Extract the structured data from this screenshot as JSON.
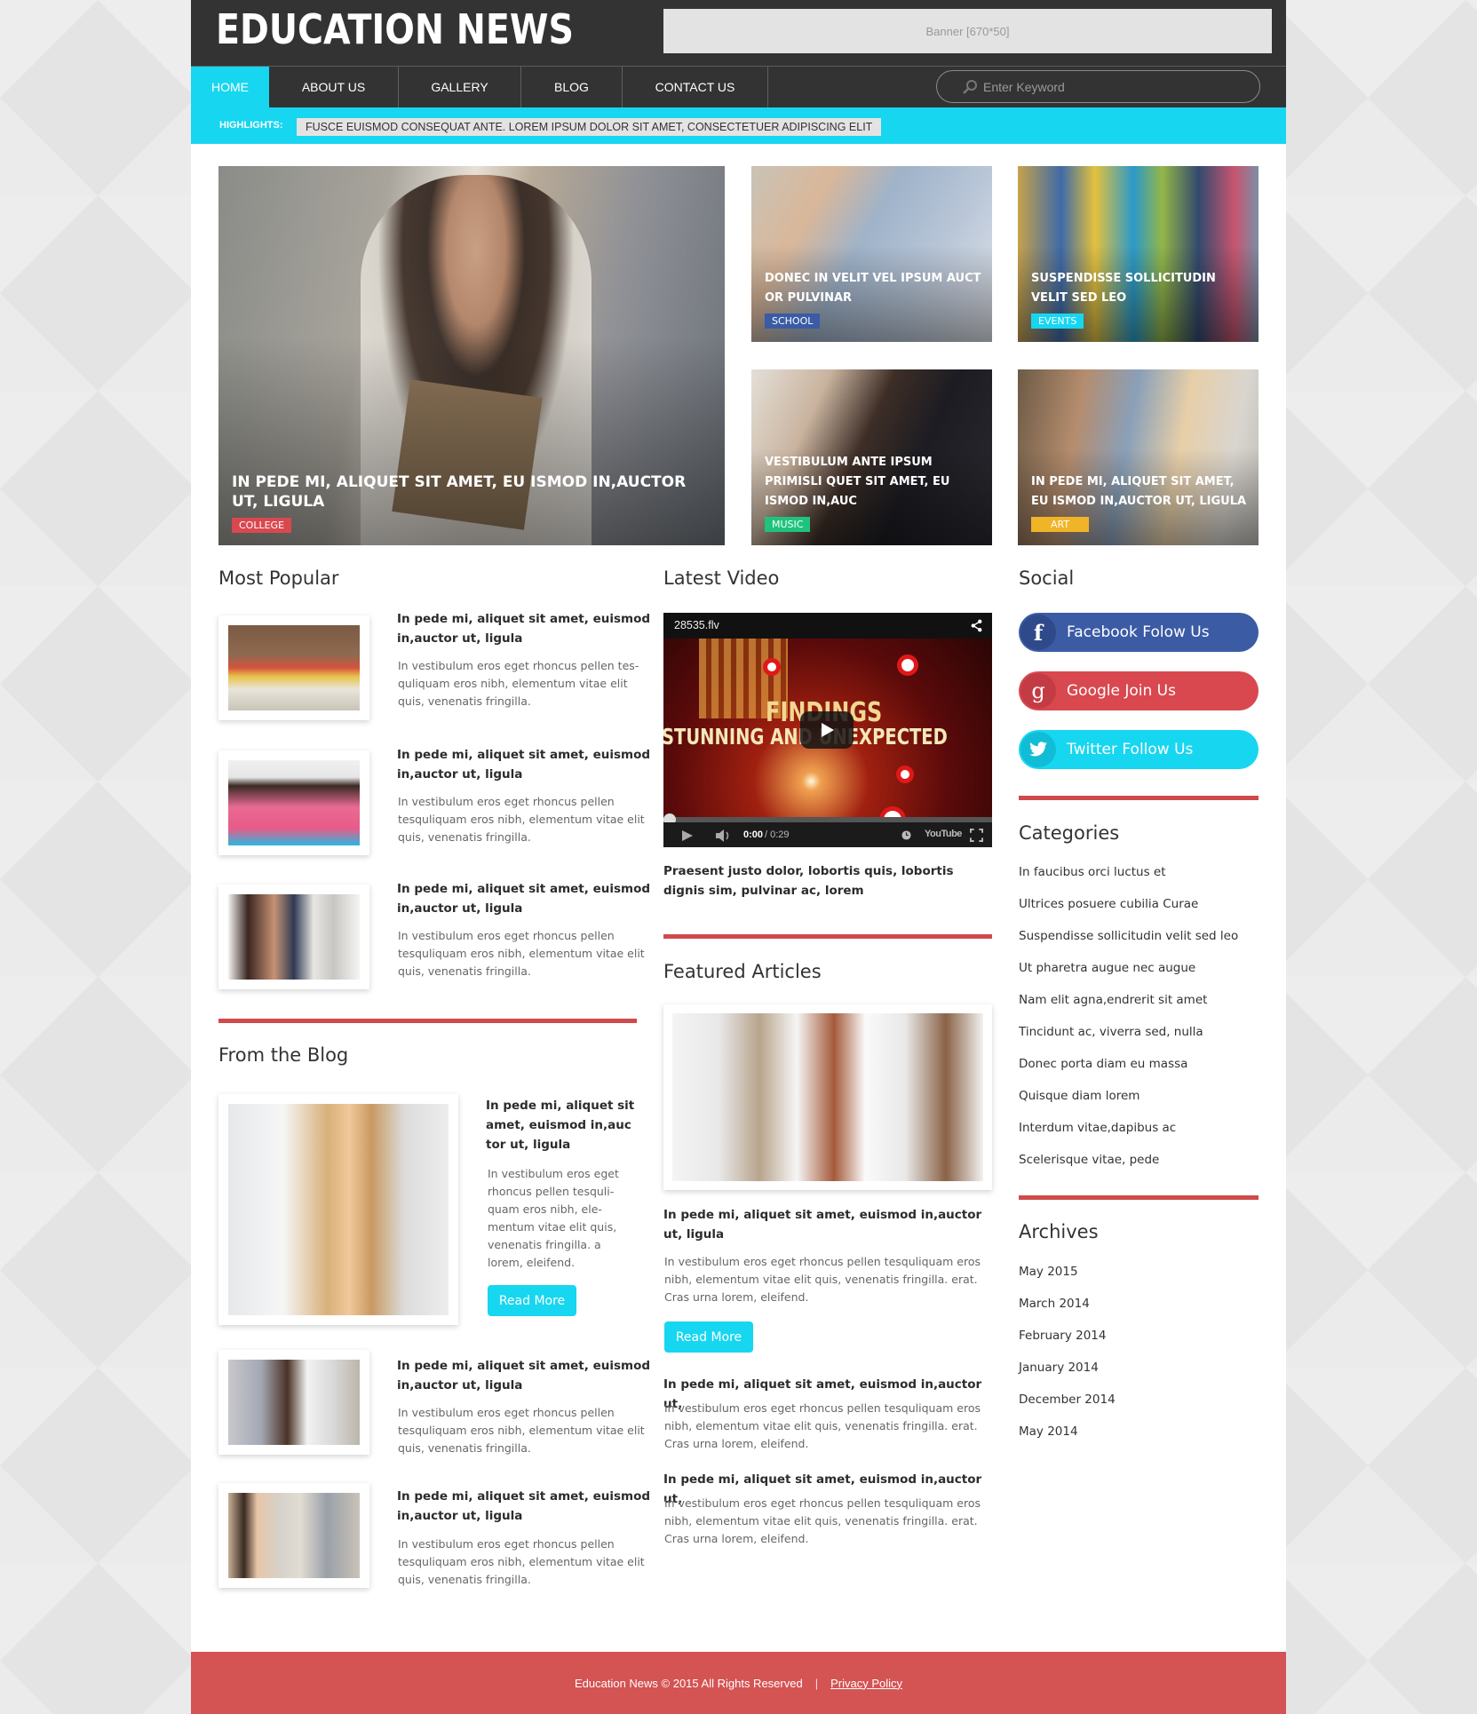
{
  "site": {
    "logo": "EDUCATION NEWS",
    "banner": "Banner [670*50]"
  },
  "nav": {
    "items": [
      {
        "label": "HOME",
        "active": true
      },
      {
        "label": "ABOUT US",
        "active": false
      },
      {
        "label": "GALLERY",
        "active": false
      },
      {
        "label": "BLOG",
        "active": false
      },
      {
        "label": "CONTACT US",
        "active": false
      }
    ],
    "search_placeholder": "Enter Keyword",
    "search_value": ""
  },
  "highlights": {
    "label": "HIGHLIGHTS:",
    "text": "FUSCE EUISMOD CONSEQUAT ANTE. LOREM IPSUM DOLOR SIT AMET, CONSECTETUER ADIPISCING ELIT"
  },
  "hero": {
    "main": {
      "title": "IN PEDE MI, ALIQUET SIT AMET, EU ISMOD IN,AUCTOR UT, LIGULA",
      "tag": "COLLEGE",
      "tag_color": "#d9484f"
    },
    "tiles": [
      {
        "title": "DONEC IN VELIT VEL IPSUM AUCT OR PULVINAR",
        "tag": "SCHOOL",
        "tag_color": "#3b5ba5"
      },
      {
        "title": "SUSPENDISSE SOLLICITUDIN VELIT SED LEO",
        "tag": "EVENTS",
        "tag_color": "#17d6f0"
      },
      {
        "title": "VESTIBULUM ANTE IPSUM PRIMISLI QUET SIT AMET, EU ISMOD IN,AUC",
        "tag": "MUSIC",
        "tag_color": "#1fc37e"
      },
      {
        "title": "IN PEDE MI, ALIQUET SIT AMET, EU ISMOD IN,AUCTOR UT, LIGULA",
        "tag": "ART",
        "tag_color": "#f0b429"
      }
    ]
  },
  "most_popular": {
    "heading": "Most Popular",
    "items": [
      {
        "title": "In pede mi, aliquet sit amet, euismod in,auctor ut, ligula",
        "text": "In vestibulum eros eget rhoncus pellen tes-quliquam eros nibh, elementum vitae elit quis, venenatis fringilla."
      },
      {
        "title": "In pede mi, aliquet sit amet, euismod in,auctor ut, ligula",
        "text": "In vestibulum eros eget rhoncus pellen tesquliquam eros nibh, elementum vitae elit quis, venenatis fringilla."
      },
      {
        "title": "In pede mi, aliquet sit amet, euismod in,auctor ut, ligula",
        "text": "In vestibulum eros eget rhoncus pellen tesquliquam eros nibh, elementum vitae elit quis, venenatis fringilla."
      }
    ]
  },
  "blog": {
    "heading": "From the Blog",
    "featured": {
      "title": "In pede mi, aliquet sit amet, euismod in,auc tor ut, ligula",
      "text": "In vestibulum eros eget rhoncus pellen tesquli-quam eros nibh, ele-mentum vitae elit quis, venenatis fringilla. a lorem, eleifend.",
      "button": "Read More"
    },
    "items": [
      {
        "title": "In pede mi, aliquet sit amet, euismod in,auctor ut, ligula",
        "text": "In vestibulum eros eget rhoncus pellen tesquliquam eros nibh, elementum vitae elit quis, venenatis fringilla."
      },
      {
        "title": "In pede mi, aliquet sit amet, euismod in,auctor ut, ligula",
        "text": "In vestibulum eros eget rhoncus pellen tesquliquam eros nibh, elementum vitae elit quis, venenatis fringilla."
      }
    ]
  },
  "video": {
    "heading": "Latest Video",
    "filename": "28535.flv",
    "overlay_line1": "FINDINGS",
    "overlay_line2": "STUNNING AND UNEXPECTED",
    "time_current": "0:00",
    "time_total": "/ 0:29",
    "progress": 0,
    "brand": "YouTube",
    "caption": "Praesent justo dolor, lobortis quis, lobortis dignis sim, pulvinar ac, lorem"
  },
  "featured": {
    "heading": "Featured Articles",
    "main": {
      "title": "In pede mi, aliquet sit amet, euismod in,auctor ut, ligula",
      "text": "In vestibulum eros eget rhoncus pellen tesquliquam eros nibh, elementum vitae elit quis, venenatis fringilla. erat. Cras urna lorem, eleifend.",
      "button": "Read More"
    },
    "items": [
      {
        "title": "In pede mi, aliquet sit amet, euismod in,auctor ut,",
        "text": "In vestibulum eros eget rhoncus pellen tesquliquam eros nibh, elementum vitae elit quis, venenatis fringilla. erat. Cras urna lorem, eleifend."
      },
      {
        "title": "In pede mi, aliquet sit amet, euismod in,auctor ut,",
        "text": "In vestibulum eros eget rhoncus pellen tesquliquam eros nibh, elementum vitae elit quis, venenatis fringilla. erat. Cras urna lorem, eleifend."
      }
    ]
  },
  "social": {
    "heading": "Social",
    "buttons": [
      {
        "label": "Facebook Folow Us",
        "icon": "f",
        "color": "#3b5ba5",
        "icon_bg": "#2f4a8a"
      },
      {
        "label": "Google Join Us",
        "icon": "g",
        "color": "#d9484f",
        "icon_bg": "#c43c43"
      },
      {
        "label": "Twitter Follow Us",
        "icon": "bird",
        "color": "#17d6f0",
        "icon_bg": "#12bcd6"
      }
    ]
  },
  "categories": {
    "heading": "Categories",
    "items": [
      "In faucibus orci luctus et",
      "Ultrices posuere cubilia Curae",
      "Suspendisse sollicitudin velit sed leo",
      "Ut pharetra augue nec augue",
      "Nam elit agna,endrerit sit amet",
      "Tincidunt ac, viverra sed, nulla",
      "Donec porta diam eu massa",
      "Quisque diam lorem",
      "Interdum vitae,dapibus ac",
      "Scelerisque vitae, pede"
    ]
  },
  "archives": {
    "heading": "Archives",
    "items": [
      "May 2015",
      "March 2014",
      "February 2014",
      "January 2014",
      "December 2014",
      "May 2014"
    ]
  },
  "footer": {
    "copyright": "Education News © 2015 All Rights Reserved",
    "separator": "|",
    "privacy": "Privacy Policy"
  },
  "colors": {
    "accent": "#17d6f0",
    "dark": "#333333",
    "red": "#d04a4a",
    "footer": "#d45353"
  }
}
